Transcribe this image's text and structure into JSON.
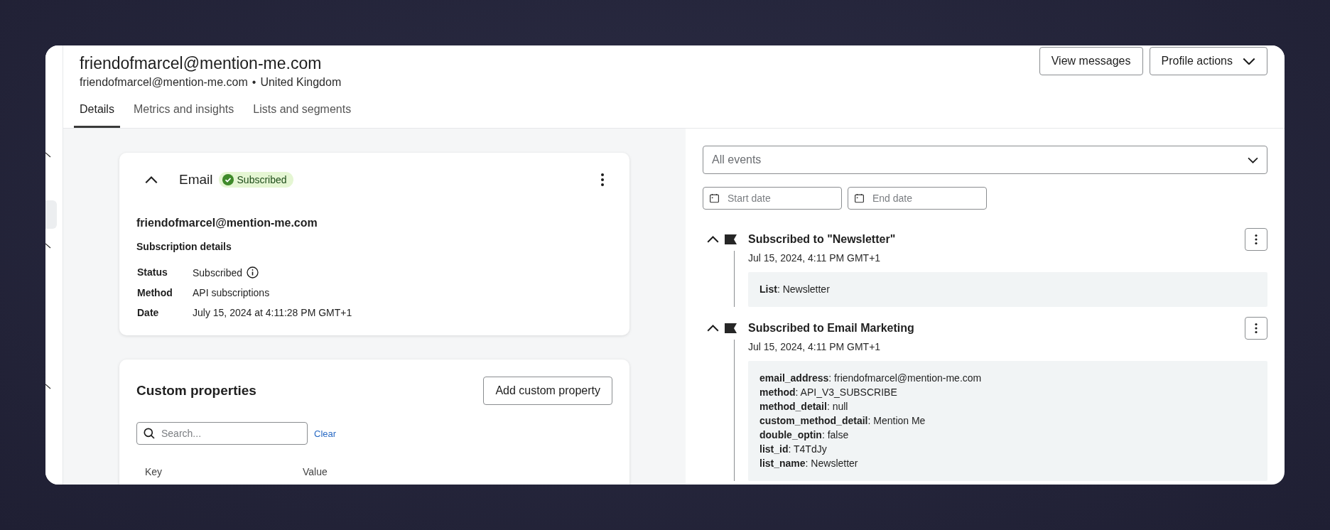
{
  "header": {
    "title": "friendofmarcel@mention-me.com",
    "subtitle_email": "friendofmarcel@mention-me.com",
    "separator": "•",
    "subtitle_country": "United Kingdom",
    "buttons": [
      {
        "label": "View messages",
        "kind": "plain"
      },
      {
        "label": "Profile actions",
        "kind": "dropdown"
      }
    ]
  },
  "tabs": [
    {
      "label": "Details",
      "selected": true
    },
    {
      "label": "Metrics and insights",
      "selected": false
    },
    {
      "label": "Lists and segments",
      "selected": false
    }
  ],
  "email_card": {
    "title": "Email",
    "expanded": true,
    "status_badge": "Subscribed",
    "address": "friendofmarcel@mention-me.com",
    "section_title": "Subscription details",
    "details": [
      {
        "label": "Status",
        "value": "Subscribed",
        "info": true
      },
      {
        "label": "Method",
        "value": "API subscriptions",
        "info": false
      },
      {
        "label": "Date",
        "value": "July 15, 2024 at 4:11:28 PM GMT+1",
        "info": false
      }
    ]
  },
  "custom_properties": {
    "title": "Custom properties",
    "add_button": "Add custom property",
    "search": {
      "placeholder": "Search..."
    },
    "clear_link": "Clear",
    "columns": [
      "Key",
      "Value"
    ]
  },
  "activity": {
    "filter": {
      "placeholder": "All events"
    },
    "date_fields": [
      {
        "placeholder": "Start date"
      },
      {
        "placeholder": "End date"
      }
    ],
    "events": [
      {
        "title": "Subscribed to \"Newsletter\"",
        "time": "Jul 15, 2024, 4:11 PM GMT+1",
        "expanded": true,
        "properties": [
          "**List**: Newsletter"
        ]
      },
      {
        "title": "Subscribed to Email Marketing",
        "time": "Jul 15, 2024, 4:11 PM GMT+1",
        "expanded": true,
        "properties": [
          "**email_address**: friendofmarcel@mention-me.com",
          "**method**: API_V3_SUBSCRIBE",
          "**method_detail**: null",
          "**custom_method_detail**: Mention Me",
          "**double_optin**: false",
          "**list_id**: T4TdJy",
          "**list_name**: Newsletter"
        ]
      }
    ]
  }
}
